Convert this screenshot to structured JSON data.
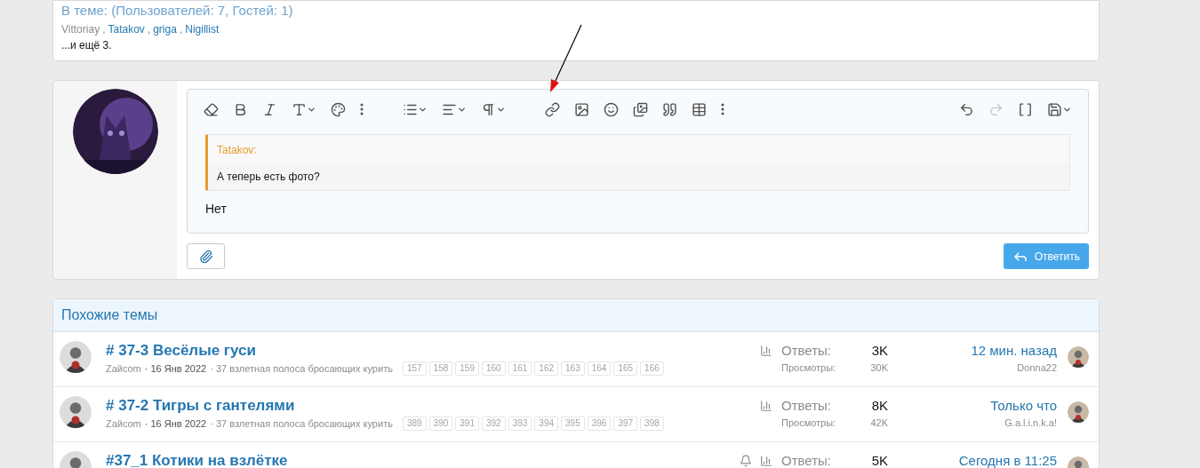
{
  "online": {
    "title": "В теме: (Пользователей: 7, Гостей: 1)",
    "users": [
      {
        "name": "Vittoriay",
        "link": false,
        "separator": ","
      },
      {
        "name": "Tatakov",
        "link": true,
        "separator": ","
      },
      {
        "name": "griga",
        "link": true,
        "separator": ","
      },
      {
        "name": "Nigillist",
        "link": true
      }
    ],
    "more": "...и ещё 3."
  },
  "editor": {
    "redo": {
      "disabled": true
    },
    "quote": {
      "author": "Tatakov:",
      "text": "А теперь есть фото?"
    },
    "text": "Нет",
    "reply_button": "Ответить"
  },
  "similar": {
    "title": "Похожие темы",
    "threads": [
      {
        "title": "# 37-3 Весёлые гуси",
        "author": "Zaйcom",
        "date": "· 16 Янв 2022",
        "forum": "· 37 взлетная полоса бросающих курить",
        "pages": [
          "157",
          "158",
          "159",
          "160",
          "161",
          "162",
          "163",
          "164",
          "165",
          "166"
        ],
        "watched": false,
        "replies_label": "Ответы:",
        "replies": "3K",
        "views_label": "Просмотры:",
        "views": "30K",
        "last_time": "12 мин. назад",
        "last_user": "Donna22"
      },
      {
        "title": "# 37-2 Тигры с гантелями",
        "author": "Zaйcom",
        "date": "· 16 Янв 2022",
        "forum": "· 37 взлетная полоса бросающих курить",
        "pages": [
          "389",
          "390",
          "391",
          "392",
          "393",
          "394",
          "395",
          "396",
          "397",
          "398"
        ],
        "watched": false,
        "replies_label": "Ответы:",
        "replies": "8K",
        "views_label": "Просмотры:",
        "views": "42K",
        "last_time": "Только что",
        "last_user": "G.a.l.i.n.k.a!"
      },
      {
        "title": "#37_1 Котики на взлётке",
        "watched": true,
        "replies_label": "Ответы:",
        "replies": "5K",
        "last_time": "Сегодня в 11:25"
      }
    ]
  }
}
